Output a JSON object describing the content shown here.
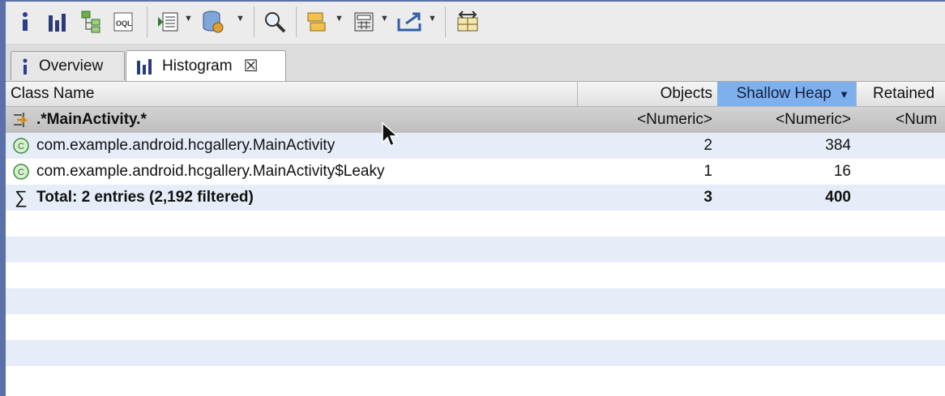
{
  "toolbar": {
    "icons": [
      "info-icon",
      "histogram-icon",
      "dominator-tree-icon",
      "oql-icon",
      "report-icon",
      "heap-dump-icon",
      "search-icon",
      "query-browser-icon",
      "calculator-icon",
      "export-icon",
      "compare-icon"
    ]
  },
  "tabs": [
    {
      "label": "Overview",
      "icon": "info-icon"
    },
    {
      "label": "Histogram",
      "icon": "histogram-icon"
    }
  ],
  "table": {
    "headers": {
      "class_name": "Class Name",
      "objects": "Objects",
      "shallow_heap": "Shallow Heap",
      "retained": "Retained"
    },
    "filter_row": {
      "pattern": ".*MainActivity.*",
      "objects": "<Numeric>",
      "shallow_heap": "<Numeric>",
      "retained": "<Num"
    },
    "rows": [
      {
        "class_name": "com.example.android.hcgallery.MainActivity",
        "objects": "2",
        "shallow_heap": "384"
      },
      {
        "class_name": "com.example.android.hcgallery.MainActivity$Leaky",
        "objects": "1",
        "shallow_heap": "16"
      }
    ],
    "total": {
      "label": "Total: 2 entries (2,192 filtered)",
      "objects": "3",
      "shallow_heap": "400"
    }
  },
  "colors": {
    "selected_header": "#7fb0ee",
    "stripe": "#e6edf8",
    "frame": "#5b6fa8"
  }
}
